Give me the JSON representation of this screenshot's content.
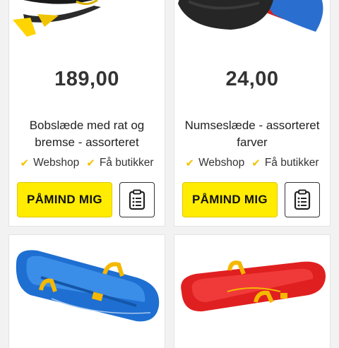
{
  "products": [
    {
      "price": "189,00",
      "name": "Bobslæde med rat og bremse - assorteret",
      "webshop": "Webshop",
      "stores": "Få butikker",
      "remind_label": "PÅMIND MIG",
      "image_icon": "black-bobsled-image"
    },
    {
      "price": "24,00",
      "name": "Numseslæde - assorteret farver",
      "webshop": "Webshop",
      "stores": "Få butikker",
      "remind_label": "PÅMIND MIG",
      "image_icon": "butt-sled-image"
    },
    {
      "image_icon": "blue-sled-image",
      "color": "#1e6fd1"
    },
    {
      "image_icon": "red-sled-image",
      "color": "#e02020"
    }
  ],
  "colors": {
    "accent": "#ffec00",
    "check": "#f2c300"
  },
  "icons": {
    "check": "check-icon",
    "shopping_list": "clipboard-list-icon"
  }
}
